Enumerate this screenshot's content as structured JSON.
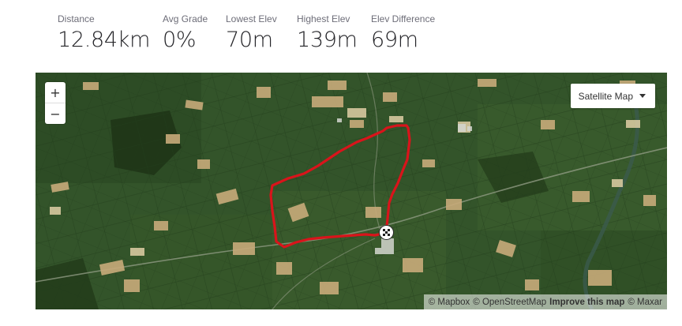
{
  "stats": [
    {
      "label": "Distance",
      "value": "12.84km"
    },
    {
      "label": "Avg Grade",
      "value": "0%"
    },
    {
      "label": "Lowest Elev",
      "value": "70m"
    },
    {
      "label": "Highest Elev",
      "value": "139m"
    },
    {
      "label": "Elev Difference",
      "value": "69m"
    }
  ],
  "map": {
    "zoom_in": "+",
    "zoom_out": "−",
    "map_type": "Satellite Map",
    "route_color": "#d9141b",
    "attribution": {
      "mapbox": "© Mapbox",
      "osm": "© OpenStreetMap",
      "improve": "Improve this map",
      "maxar": "© Maxar"
    },
    "icons": {
      "zoom_in": "plus-icon",
      "zoom_out": "minus-icon",
      "dropdown": "caret-down-icon",
      "finish": "checkered-flag-icon"
    }
  }
}
